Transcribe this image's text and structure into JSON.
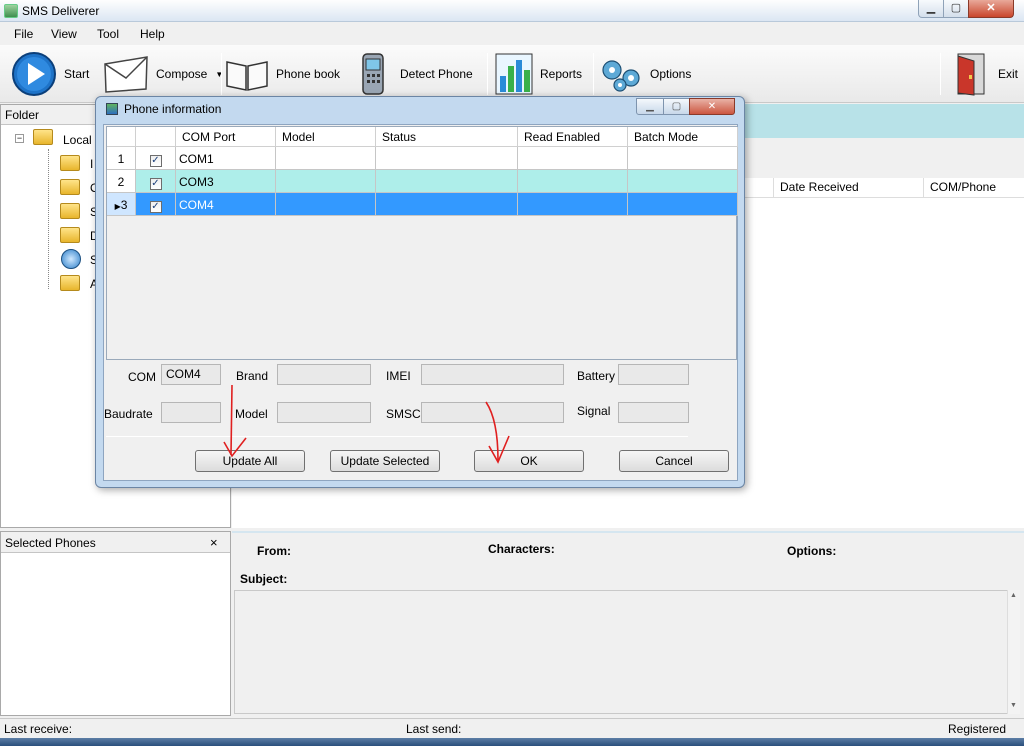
{
  "window": {
    "title": "SMS Deliverer",
    "min": "▁",
    "max": "▢",
    "close": "✕"
  },
  "menu": [
    "File",
    "View",
    "Tool",
    "Help"
  ],
  "toolbar": {
    "start": "Start",
    "compose": "Compose",
    "phonebook": "Phone book",
    "detect": "Detect Phone",
    "reports": "Reports",
    "options": "Options",
    "exit": "Exit"
  },
  "folder_pane": {
    "title": "Folder",
    "root": "Local",
    "children": [
      "I",
      "O",
      "S",
      "D",
      "S",
      "A"
    ]
  },
  "selected_pane": {
    "title": "Selected Phones",
    "close": "×"
  },
  "list_columns": {
    "date": "Date Received",
    "com": "COM/Phone"
  },
  "details": {
    "from": "From:",
    "characters": "Characters:",
    "options": "Options:",
    "subject": "Subject:"
  },
  "status": {
    "last_receive": "Last receive:",
    "last_send": "Last send:",
    "registered": "Registered"
  },
  "dialog": {
    "title": "Phone information",
    "columns": [
      "COM Port",
      "Model",
      "Status",
      "Read Enabled",
      "Batch Mode"
    ],
    "rows": [
      {
        "num": "1",
        "checked": "✓",
        "com": "COM1"
      },
      {
        "num": "2",
        "checked": "✓",
        "com": "COM3"
      },
      {
        "num": "3",
        "checked": "✓",
        "com": "COM4"
      }
    ],
    "fields": {
      "com_label": "COM",
      "com_value": "COM4",
      "brand_label": "Brand",
      "imei_label": "IMEI",
      "battery_label": "Battery",
      "baud_label": "Baudrate",
      "model_label": "Model",
      "smsc_label": "SMSC",
      "signal_label": "Signal"
    },
    "buttons": {
      "update_all": "Update All",
      "update_selected": "Update Selected",
      "ok": "OK",
      "cancel": "Cancel"
    }
  },
  "colors": {
    "selected_row": "#3399ff",
    "alt_row": "#aeeeea",
    "inbox_strip": "#b8e2e8"
  }
}
